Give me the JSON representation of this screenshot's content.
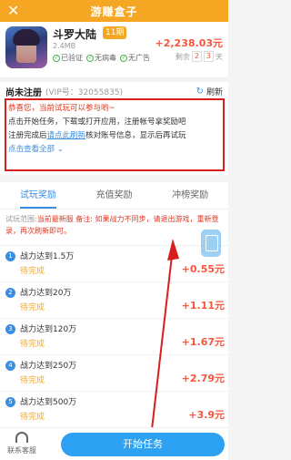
{
  "header": {
    "close_icon": "close-x-icon",
    "title": "游赚盒子"
  },
  "game": {
    "name": "斗罗大陆",
    "period": "11期",
    "size": "2.4MB",
    "tags": [
      "已验证",
      "无病毒",
      "无广告"
    ],
    "reward": "+2,238.03元",
    "remain_label": "剩余",
    "remain_digits": [
      "2",
      "3"
    ],
    "remain_unit": "天"
  },
  "status": {
    "title": "尚未注册",
    "vip": "(VIP号：32055835)",
    "refresh_label": "刷新",
    "notice_line1": "恭喜您，当前试玩可以参与哟~",
    "notice_line2": "点击开始任务，下载或打开应用，注册帐号拿奖励吧",
    "notice_line3_a": "注册完成后",
    "notice_line3_link": "请点此刷新",
    "notice_line3_b": "核对账号信息，显示后再试玩",
    "notice_line4": "点击查看全部 ⌄"
  },
  "tabs": [
    {
      "label": "试玩奖励",
      "active": true
    },
    {
      "label": "充值奖励",
      "active": false
    },
    {
      "label": "冲榜奖励",
      "active": false
    }
  ],
  "rule": {
    "label": "试玩范围:",
    "text": "当前最新服 备注: 如果战力不同步，请退出游戏，重新登录，再次刷新即可。"
  },
  "tasks": [
    {
      "index": "1",
      "name": "战力达到1.5万",
      "state": "待完成",
      "amount": "+0.55元"
    },
    {
      "index": "2",
      "name": "战力达到20万",
      "state": "待完成",
      "amount": "+1.11元"
    },
    {
      "index": "3",
      "name": "战力达到120万",
      "state": "待完成",
      "amount": "+1.67元"
    },
    {
      "index": "4",
      "name": "战力达到250万",
      "state": "待完成",
      "amount": "+2.79元"
    },
    {
      "index": "5",
      "name": "战力达到500万",
      "state": "待完成",
      "amount": "+3.9元"
    }
  ],
  "bottom": {
    "service_label": "联系客服",
    "start_label": "开始任务"
  },
  "colors": {
    "accent": "#f5a623",
    "blue": "#2ea2f2",
    "reward": "#f5573d",
    "alert": "#d71e1e"
  }
}
